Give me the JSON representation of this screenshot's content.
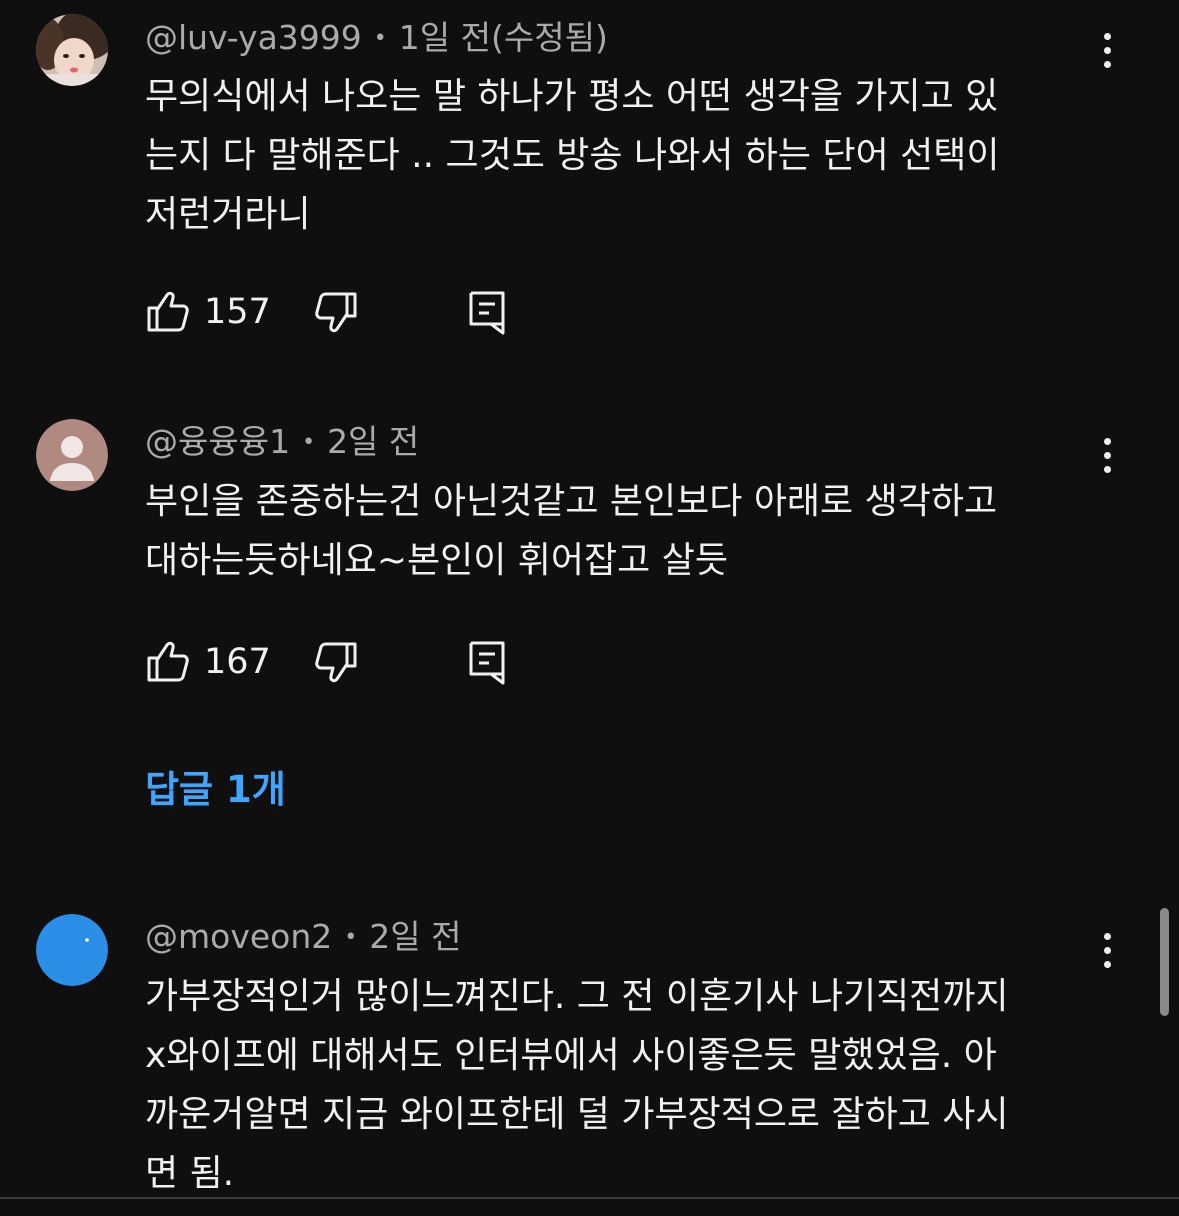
{
  "comments": [
    {
      "author": "@luv-ya3999",
      "separator": "•",
      "time": "1일 전(수정됨)",
      "lines": [
        "무의식에서 나오는 말 하나가 평소 어떤 생각을 가지고 있",
        "는지 다 말해준다 .. 그것도 방송 나와서 하는 단어 선택이",
        "저런거라니"
      ],
      "likes": "157",
      "avatar": "photo-avatar"
    },
    {
      "author": "@융융융1",
      "separator": "•",
      "time": "2일 전",
      "lines": [
        "부인을 존중하는건 아닌것같고 본인보다 아래로 생각하고",
        "대하는듯하네요~본인이 휘어잡고 살듯"
      ],
      "likes": "167",
      "avatar": "default-person-avatar"
    },
    {
      "author": "@moveon2",
      "separator": "•",
      "time": "2일 전",
      "lines": [
        "가부장적인거 많이느껴진다. 그 전 이혼기사 나기직전까지",
        "x와이프에 대해서도 인터뷰에서 사이좋은듯 말했었음. 아",
        "까운거알면 지금 와이프한테 덜 가부장적으로 잘하고 사시",
        "면 됨."
      ],
      "avatar": "blue-avatar"
    }
  ],
  "replies": {
    "label": "답글 1개"
  },
  "colors": {
    "background": "#0f0f0f",
    "text": "#f1f1f1",
    "meta": "#aaaaaa",
    "link": "#3ea6ff",
    "blue_avatar": "#2b8fe8"
  }
}
